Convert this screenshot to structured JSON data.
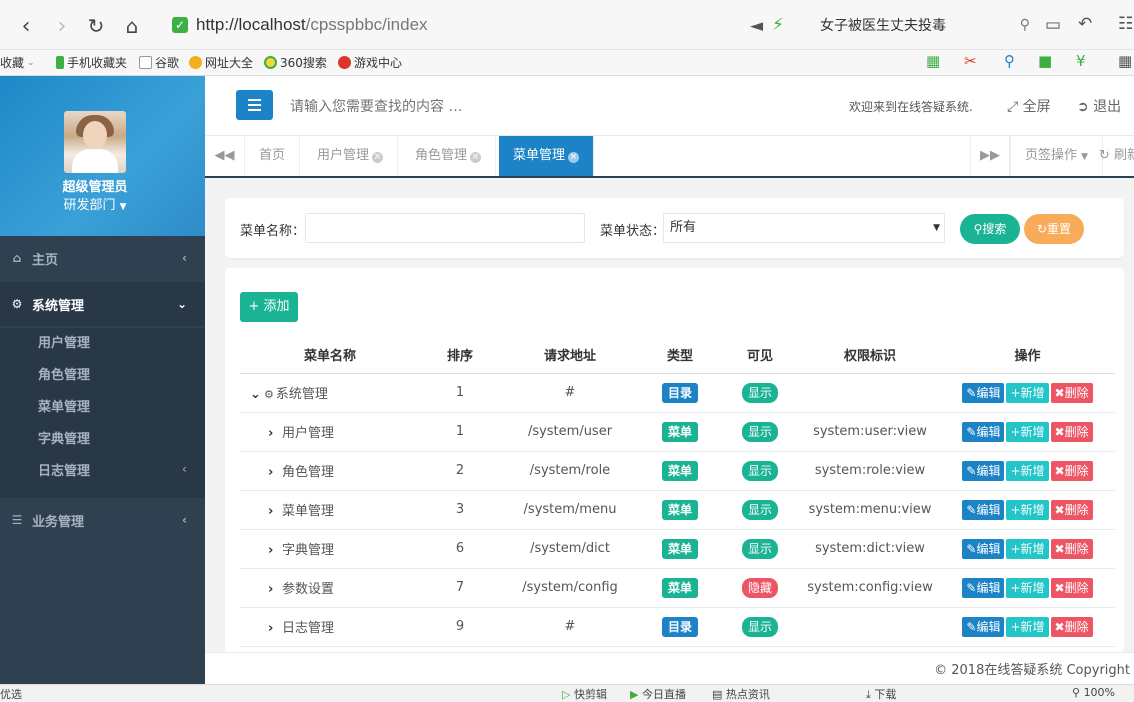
{
  "browser": {
    "url_host": "http://localhost",
    "url_path": "/cpsspbbc/index",
    "search_text": "女子被医生丈夫投毒",
    "bookmarks": [
      "收藏",
      "手机收藏夹",
      "谷歌",
      "网址大全",
      "360搜索",
      "游戏中心"
    ]
  },
  "profile": {
    "name": "超级管理员",
    "dept": "研发部门"
  },
  "sidebar": {
    "home": "主页",
    "system": "系统管理",
    "system_items": [
      "用户管理",
      "角色管理",
      "菜单管理",
      "字典管理",
      "日志管理"
    ],
    "business": "业务管理"
  },
  "header": {
    "search_placeholder": "请输入您需要查找的内容 …",
    "welcome": "欢迎来到在线答疑系统.",
    "fullscreen": "全屏",
    "logout": "退出"
  },
  "tabs": {
    "items": [
      "首页",
      "用户管理",
      "角色管理",
      "菜单管理"
    ],
    "active": "菜单管理",
    "page_ops": "页签操作",
    "refresh": "刷新"
  },
  "search_form": {
    "name_label": "菜单名称：",
    "status_label": "菜单状态：",
    "status_value": "所有",
    "search_btn": "搜索",
    "reset_btn": "重置"
  },
  "table": {
    "add_btn": "添加",
    "headers": [
      "菜单名称",
      "排序",
      "请求地址",
      "类型",
      "可见",
      "权限标识",
      "操作"
    ],
    "rows": [
      {
        "name": "系统管理",
        "order": "1",
        "url": "#",
        "type": "目录",
        "type_kind": "dir",
        "visible": "显示",
        "visible_kind": "show",
        "perm": "",
        "expanded": true,
        "level": 0
      },
      {
        "name": "用户管理",
        "order": "1",
        "url": "/system/user",
        "type": "菜单",
        "type_kind": "menu",
        "visible": "显示",
        "visible_kind": "show",
        "perm": "system:user:view",
        "expanded": false,
        "level": 1
      },
      {
        "name": "角色管理",
        "order": "2",
        "url": "/system/role",
        "type": "菜单",
        "type_kind": "menu",
        "visible": "显示",
        "visible_kind": "show",
        "perm": "system:role:view",
        "expanded": false,
        "level": 1
      },
      {
        "name": "菜单管理",
        "order": "3",
        "url": "/system/menu",
        "type": "菜单",
        "type_kind": "menu",
        "visible": "显示",
        "visible_kind": "show",
        "perm": "system:menu:view",
        "expanded": false,
        "level": 1
      },
      {
        "name": "字典管理",
        "order": "6",
        "url": "/system/dict",
        "type": "菜单",
        "type_kind": "menu",
        "visible": "显示",
        "visible_kind": "show",
        "perm": "system:dict:view",
        "expanded": false,
        "level": 1
      },
      {
        "name": "参数设置",
        "order": "7",
        "url": "/system/config",
        "type": "菜单",
        "type_kind": "menu",
        "visible": "隐藏",
        "visible_kind": "hide",
        "perm": "system:config:view",
        "expanded": false,
        "level": 1
      },
      {
        "name": "日志管理",
        "order": "9",
        "url": "#",
        "type": "目录",
        "type_kind": "dir",
        "visible": "显示",
        "visible_kind": "show",
        "perm": "",
        "expanded": false,
        "level": 1
      }
    ],
    "op_edit": "编辑",
    "op_new": "新增",
    "op_delete": "删除"
  },
  "footer": {
    "copyright": "© 2018在线答疑系统 Copyright"
  },
  "statusbar": {
    "left": "优选",
    "items": [
      "快剪辑",
      "今日直播",
      "热点资讯",
      "下载",
      "100%"
    ]
  },
  "colors": {
    "sidebar_bg": "#2f4050",
    "primary": "#1c84c6",
    "success": "#1ab394",
    "warning": "#f8ac59",
    "danger": "#ed5565",
    "info": "#23c6c8"
  }
}
